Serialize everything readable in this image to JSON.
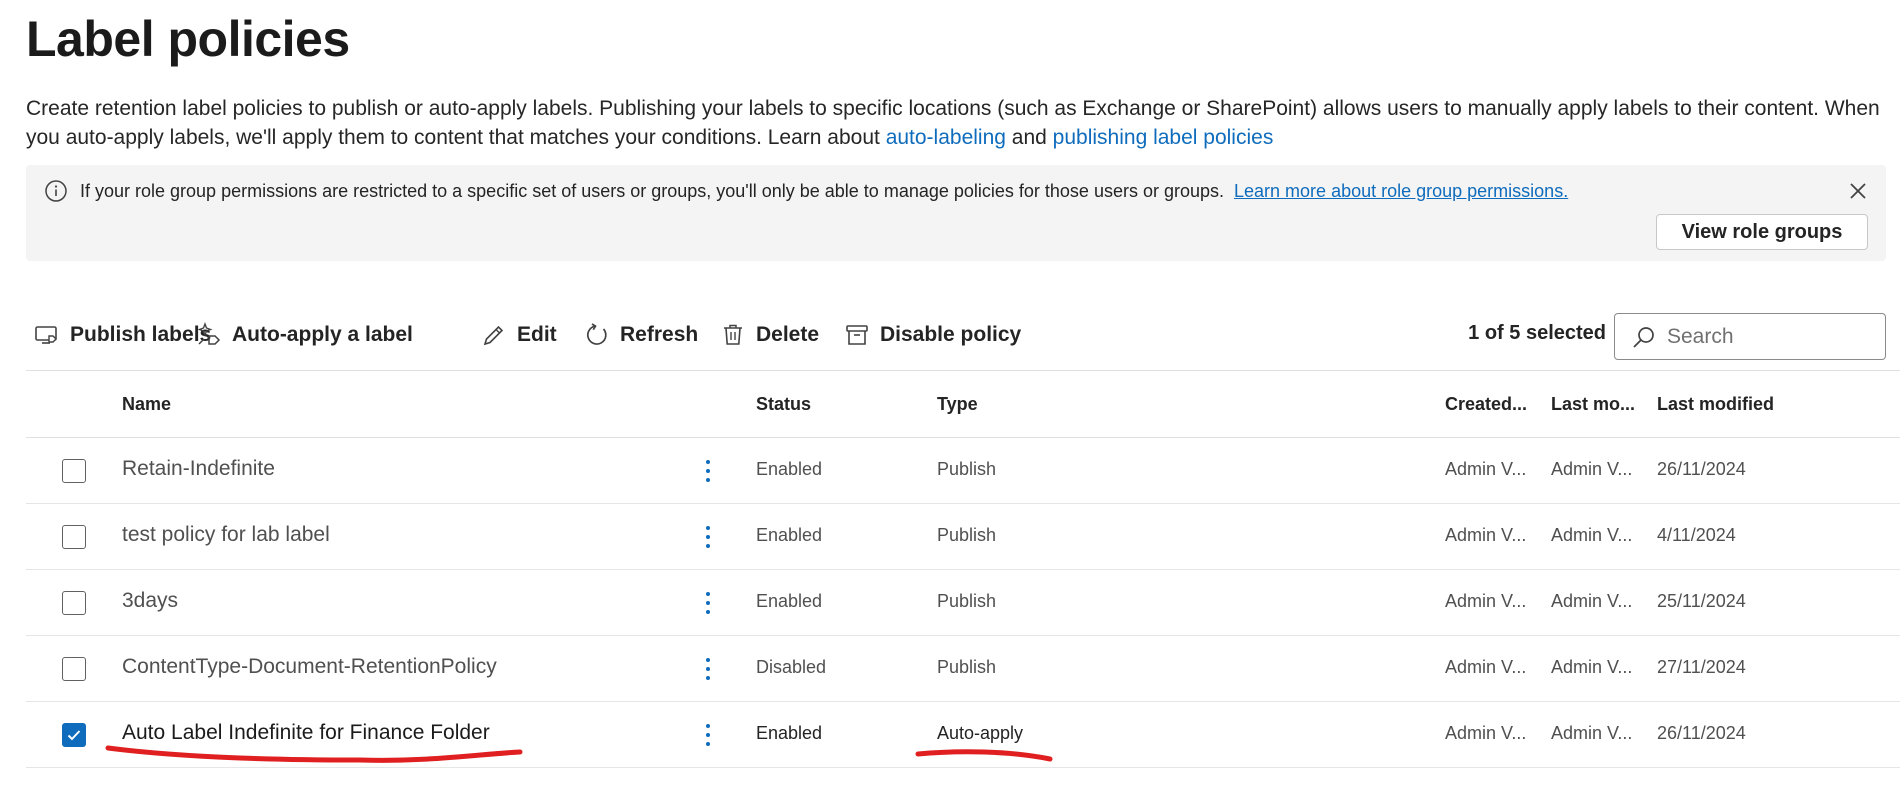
{
  "page": {
    "title": "Label policies",
    "intro_text": "Create retention label policies to publish or auto-apply labels. Publishing your labels to specific locations (such as Exchange or SharePoint) allows users to manually apply labels to their content. When you auto-apply labels, we'll apply them to content that matches your conditions. Learn about ",
    "link_autolabeling": "auto-labeling",
    "intro_and": " and ",
    "link_publishing": "publishing label policies"
  },
  "banner": {
    "message": "If your role group permissions are restricted to a specific set of users or groups, you'll only be able to manage policies for those users or groups.",
    "link": "Learn more about role group permissions.",
    "button": "View role groups"
  },
  "toolbar": {
    "publish": "Publish labels",
    "auto_apply": "Auto-apply a label",
    "edit": "Edit",
    "refresh": "Refresh",
    "delete": "Delete",
    "disable": "Disable policy",
    "selection_count": "1 of 5 selected",
    "search_placeholder": "Search"
  },
  "table": {
    "columns": {
      "name": "Name",
      "status": "Status",
      "type": "Type",
      "created": "Created...",
      "last_mod_by": "Last mo...",
      "last_modified": "Last modified"
    },
    "rows": [
      {
        "name": "Retain-Indefinite",
        "status": "Enabled",
        "type": "Publish",
        "created": "Admin V...",
        "last_mod_by": "Admin V...",
        "last_modified": "26/11/2024",
        "selected": false
      },
      {
        "name": "test policy for lab label",
        "status": "Enabled",
        "type": "Publish",
        "created": "Admin V...",
        "last_mod_by": "Admin V...",
        "last_modified": "4/11/2024",
        "selected": false
      },
      {
        "name": "3days",
        "status": "Enabled",
        "type": "Publish",
        "created": "Admin V...",
        "last_mod_by": "Admin V...",
        "last_modified": "25/11/2024",
        "selected": false
      },
      {
        "name": "ContentType-Document-RetentionPolicy",
        "status": "Disabled",
        "type": "Publish",
        "created": "Admin V...",
        "last_mod_by": "Admin V...",
        "last_modified": "27/11/2024",
        "selected": false
      },
      {
        "name": "Auto Label Indefinite for Finance Folder",
        "status": "Enabled",
        "type": "Auto-apply",
        "created": "Admin V...",
        "last_mod_by": "Admin V...",
        "last_modified": "26/11/2024",
        "selected": true
      }
    ]
  },
  "colors": {
    "accent": "#0f6cbd",
    "annotation": "#e02020",
    "banner_bg": "#f4f4f4"
  },
  "icons": {
    "publish": "monitor-tag-icon",
    "auto_apply": "sparkle-tag-icon",
    "edit": "pencil-icon",
    "refresh": "refresh-icon",
    "delete": "trash-icon",
    "disable": "archive-icon",
    "search": "search-icon",
    "info": "info-icon",
    "close": "close-icon",
    "more": "more-vertical-icon",
    "check": "checkmark-icon"
  }
}
